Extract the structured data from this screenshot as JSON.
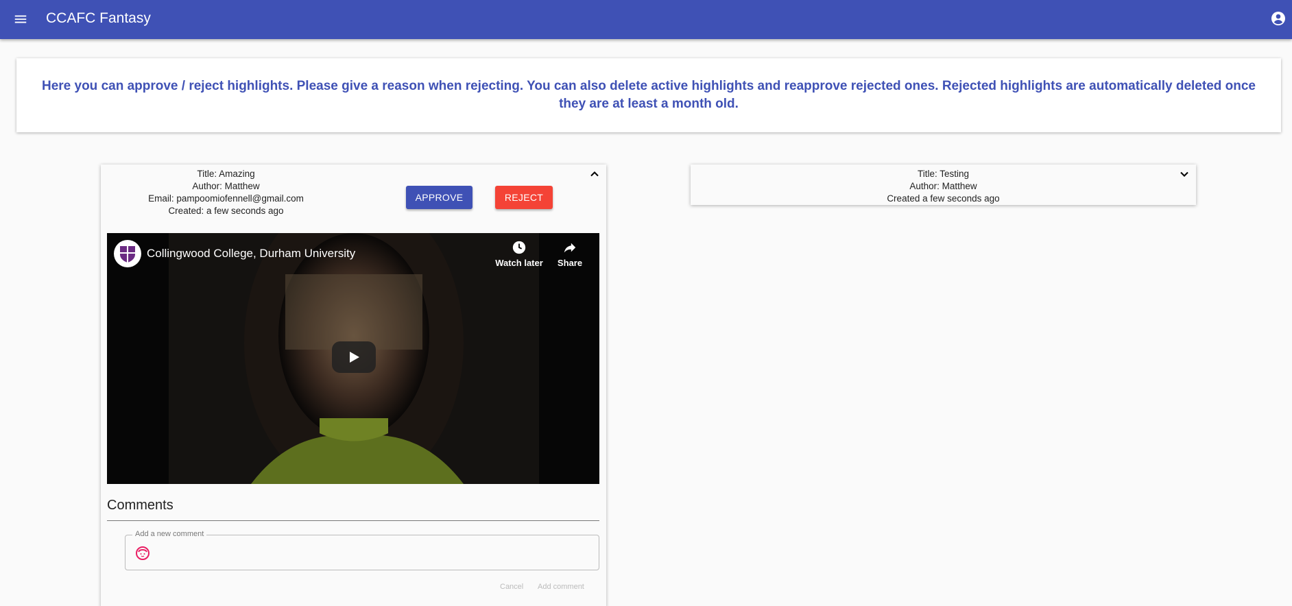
{
  "app": {
    "title": "CCAFC Fantasy"
  },
  "info": {
    "text": "Here you can approve / reject highlights. Please give a reason when rejecting. You can also delete active highlights and reapprove rejected ones. Rejected highlights are automatically deleted once they are at least a month old."
  },
  "highlights": [
    {
      "title": "Title: Amazing",
      "author": "Author: Matthew",
      "email": "Email: pampoomiofennell@gmail.com",
      "created": "Created: a few seconds ago",
      "approve_label": "APPROVE",
      "reject_label": "REJECT",
      "expanded": true,
      "video": {
        "channel": "Collingwood College, Durham University",
        "watch_later": "Watch later",
        "share": "Share"
      },
      "comments": {
        "title": "Comments",
        "field_label": "Add a new comment",
        "cancel_label": "Cancel",
        "add_label": "Add comment"
      }
    },
    {
      "title": "Title: Testing",
      "author": "Author: Matthew",
      "created": "Created a few seconds ago",
      "expanded": false
    }
  ],
  "colors": {
    "primary": "#3f51b5",
    "reject": "#f44336",
    "avatar": "#e91e63"
  }
}
